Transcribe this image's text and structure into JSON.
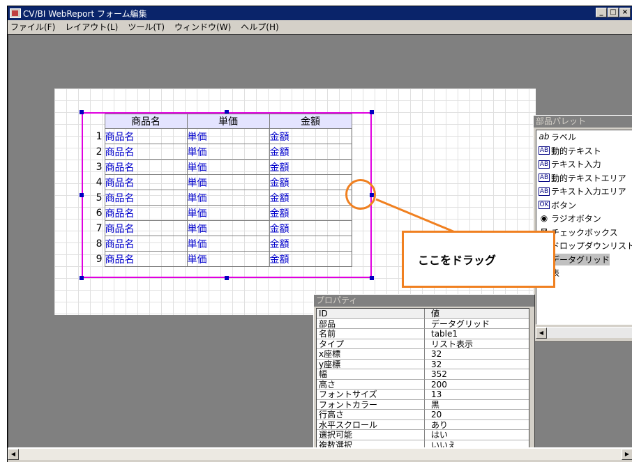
{
  "window": {
    "title": "CV/BI WebReport フォーム編集",
    "buttons": [
      "minimize",
      "maximize",
      "close"
    ]
  },
  "menubar": [
    "ファイル(F)",
    "レイアウト(L)",
    "ツール(T)",
    "ウィンドウ(W)",
    "ヘルプ(H)"
  ],
  "datagrid": {
    "headers": [
      "商品名",
      "単価",
      "金額"
    ],
    "rows": [
      {
        "n": "1",
        "c1": "商品名",
        "c2": "単価",
        "c3": "金額"
      },
      {
        "n": "2",
        "c1": "商品名",
        "c2": "単価",
        "c3": "金額"
      },
      {
        "n": "3",
        "c1": "商品名",
        "c2": "単価",
        "c3": "金額"
      },
      {
        "n": "4",
        "c1": "商品名",
        "c2": "単価",
        "c3": "金額"
      },
      {
        "n": "5",
        "c1": "商品名",
        "c2": "単価",
        "c3": "金額"
      },
      {
        "n": "6",
        "c1": "商品名",
        "c2": "単価",
        "c3": "金額"
      },
      {
        "n": "7",
        "c1": "商品名",
        "c2": "単価",
        "c3": "金額"
      },
      {
        "n": "8",
        "c1": "商品名",
        "c2": "単価",
        "c3": "金額"
      },
      {
        "n": "9",
        "c1": "商品名",
        "c2": "単価",
        "c3": "金額"
      }
    ]
  },
  "palette": {
    "title": "部品パレット",
    "items": [
      {
        "icon": "ab",
        "label": "ラベル"
      },
      {
        "icon": "AB",
        "label": "動的テキスト"
      },
      {
        "icon": "AB",
        "label": "テキスト入力"
      },
      {
        "icon": "AB",
        "label": "動的テキストエリア"
      },
      {
        "icon": "AB",
        "label": "テキスト入力エリア"
      },
      {
        "icon": "OK",
        "label": "ボタン"
      },
      {
        "icon": "◉",
        "label": "ラジオボタン"
      },
      {
        "icon": "⊠",
        "label": "チェックボックス"
      },
      {
        "icon": "▭",
        "label": "ドロップダウンリスト"
      },
      {
        "icon": "▦",
        "label": "データグリッド"
      },
      {
        "icon": "",
        "label": "表"
      }
    ]
  },
  "properties": {
    "title": "プロパティ",
    "header": {
      "key": "ID",
      "value": "値"
    },
    "rows": [
      {
        "key": "部品",
        "value": "データグリッド"
      },
      {
        "key": "名前",
        "value": "table1"
      },
      {
        "key": "タイプ",
        "value": "リスト表示"
      },
      {
        "key": "x座標",
        "value": "32"
      },
      {
        "key": "y座標",
        "value": "32"
      },
      {
        "key": "幅",
        "value": "352"
      },
      {
        "key": "高さ",
        "value": "200"
      },
      {
        "key": "フォントサイズ",
        "value": "13"
      },
      {
        "key": "フォントカラー",
        "value": "黒"
      },
      {
        "key": "行高さ",
        "value": "20"
      },
      {
        "key": "水平スクロール",
        "value": "あり"
      },
      {
        "key": "選択可能",
        "value": "はい"
      },
      {
        "key": "複数選択",
        "value": "いいえ"
      }
    ]
  },
  "callout": {
    "text": "ここをドラッグ"
  },
  "colors": {
    "selection": "#e000e0",
    "callout": "#f08020",
    "titlebar": "#0a246a",
    "cell_text": "#0000cc"
  }
}
